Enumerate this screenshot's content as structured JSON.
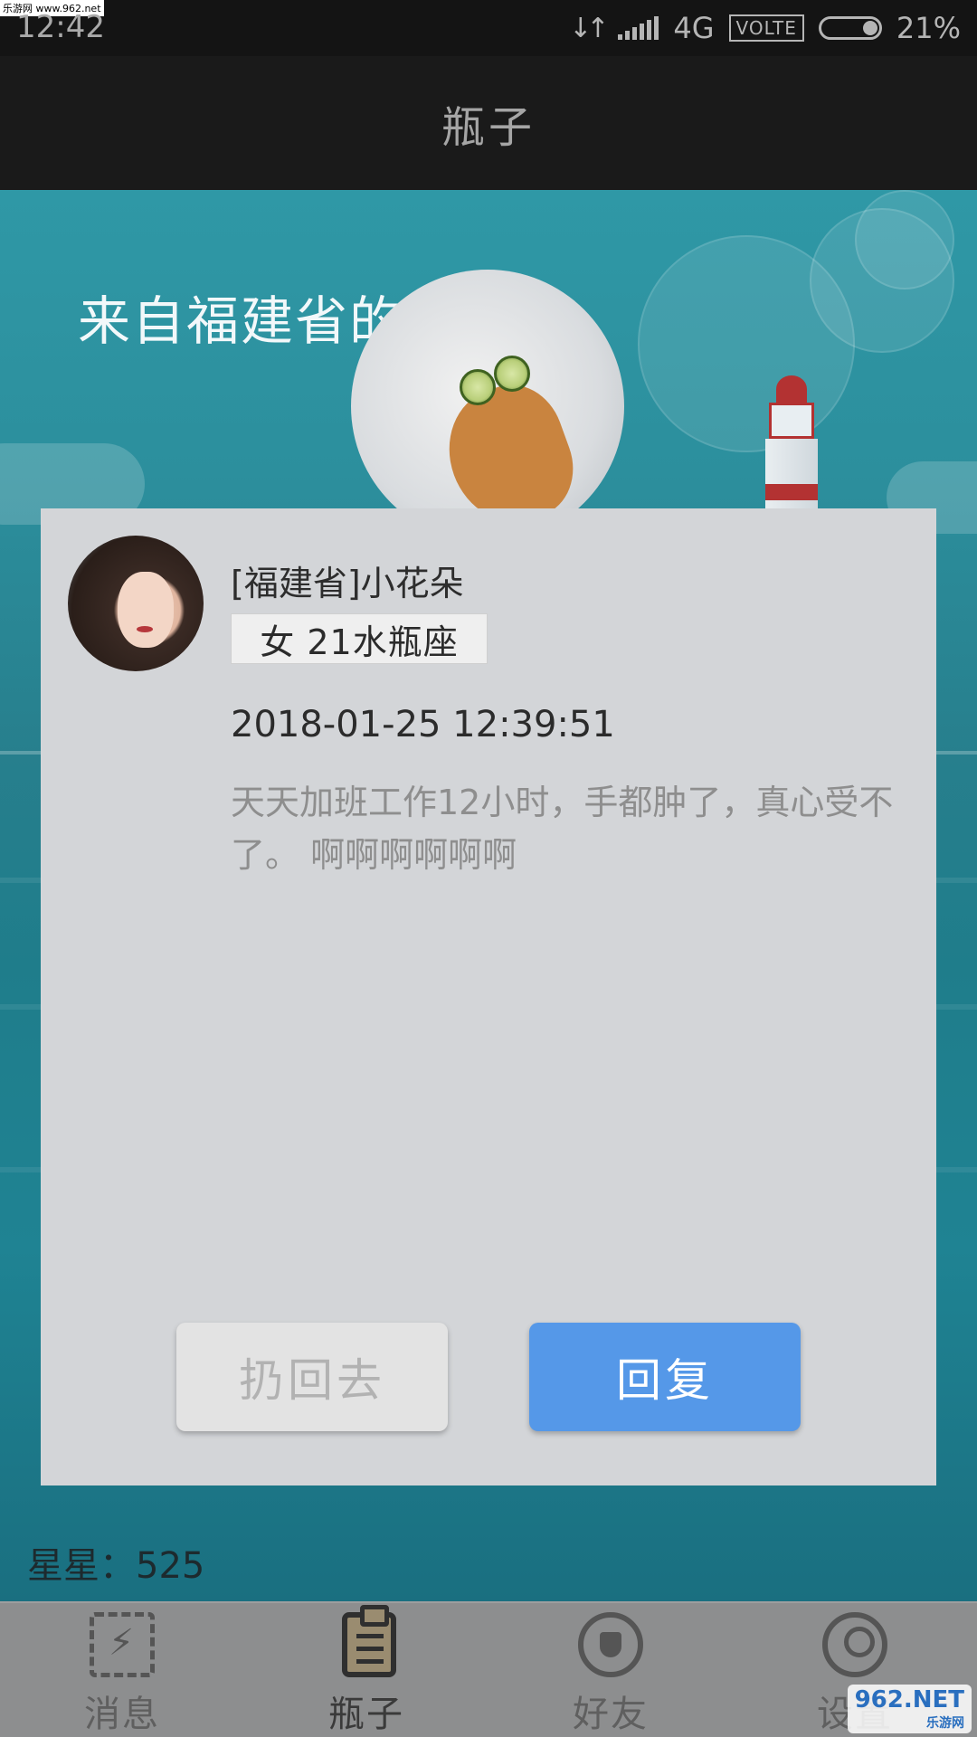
{
  "watermark_top": "乐游网 www.962.net",
  "status_bar": {
    "time": "12:42",
    "network": "4G",
    "volte": "VOLTE",
    "battery": "21%"
  },
  "header": {
    "title": "瓶子"
  },
  "scene": {
    "origin_title": "来自福建省的瓶子"
  },
  "bottle": {
    "sender_name": "[福建省]小花朵",
    "sender_tag": "女 21水瓶座",
    "timestamp": "2018-01-25 12:39:51",
    "message": "天天加班工作12小时，手都肿了，真心受不了。 啊啊啊啊啊啊"
  },
  "actions": {
    "throw_back_label": "扔回去",
    "reply_label": "回复",
    "reply_color": "#5598e8"
  },
  "stars": {
    "label": "星星：525"
  },
  "bottom_nav": {
    "items": [
      {
        "label": "消息",
        "icon": "lightning-icon"
      },
      {
        "label": "瓶子",
        "icon": "clipboard-icon",
        "active": true
      },
      {
        "label": "好友",
        "icon": "plug-icon"
      },
      {
        "label": "设置",
        "icon": "user-icon"
      }
    ]
  },
  "watermark": {
    "main": "962.NET",
    "sub": "乐游网"
  }
}
